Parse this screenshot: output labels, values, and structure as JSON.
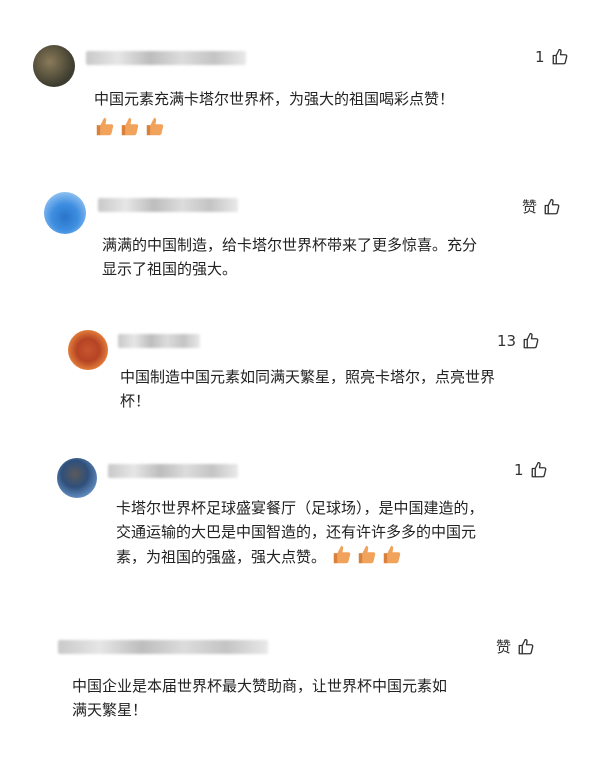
{
  "comments": [
    {
      "text": "中国元素充满卡塔尔世界杯，为强大的祖国喝彩点赞！",
      "emoji": "thumbs-up-emoji",
      "emoji_count": 3,
      "likes": "1",
      "icon": "thumbs-up-outline-icon"
    },
    {
      "text_line1": "满满的中国制造，给卡塔尔世界杯带来了更多惊喜。充分",
      "text_line2": "显示了祖国的强大。",
      "likes": "赞",
      "icon": "thumbs-up-outline-icon"
    },
    {
      "text_line1": "中国制造中国元素如同满天繁星，照亮卡塔尔，点亮世界",
      "text_line2": "杯！",
      "likes": "13",
      "icon": "thumbs-up-outline-icon"
    },
    {
      "text_line1": "卡塔尔世界杯足球盛宴餐厅（足球场），是中国建造的，",
      "text_line2": "交通运输的大巴是中国智造的，还有许许多多的中国元",
      "text_line3": "素，为祖国的强盛，强大点赞。",
      "emoji": "thumbs-up-emoji",
      "emoji_count": 3,
      "likes": "1",
      "icon": "thumbs-up-outline-icon"
    },
    {
      "text_line1": "中国企业是本届世界杯最大赞助商，让世界杯中国元素如",
      "text_line2": "满天繁星！",
      "likes": "赞",
      "icon": "thumbs-up-outline-icon"
    }
  ],
  "colors": {
    "emoji_fill": "#f2a35b",
    "emoji_shade": "#d9803a",
    "icon_stroke": "#333333"
  }
}
